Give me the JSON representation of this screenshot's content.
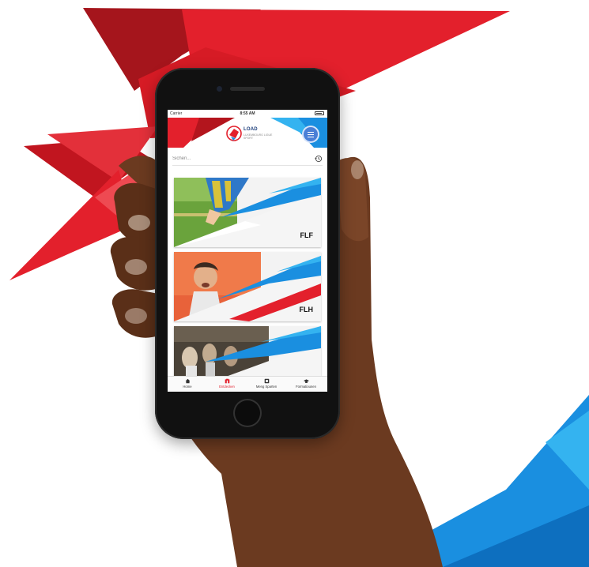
{
  "colors": {
    "red_primary": "#e3202c",
    "red_dark": "#b3151d",
    "blue_primary": "#1a8fe0",
    "blue_light": "#34b3f0",
    "phone_body": "#111111"
  },
  "status_bar": {
    "carrier": "Carrier",
    "time": "8:55 AM"
  },
  "header": {
    "logo_text": "LOAD",
    "logo_subtitle": "LUXEMBOURG LIGUE SPORT",
    "menu_icon": "hamburger-icon"
  },
  "search": {
    "placeholder": "Sichen...",
    "history_icon": "history-icon"
  },
  "cards": [
    {
      "label": "FLF"
    },
    {
      "label": "FLH"
    },
    {
      "label": ""
    }
  ],
  "tabs": [
    {
      "label": "Home",
      "icon": "home-icon"
    },
    {
      "label": "Entdecken",
      "icon": "discover-icon"
    },
    {
      "label": "Meng Sparten",
      "icon": "sports-icon"
    },
    {
      "label": "Formatiounen",
      "icon": "graduation-cap-icon"
    }
  ]
}
